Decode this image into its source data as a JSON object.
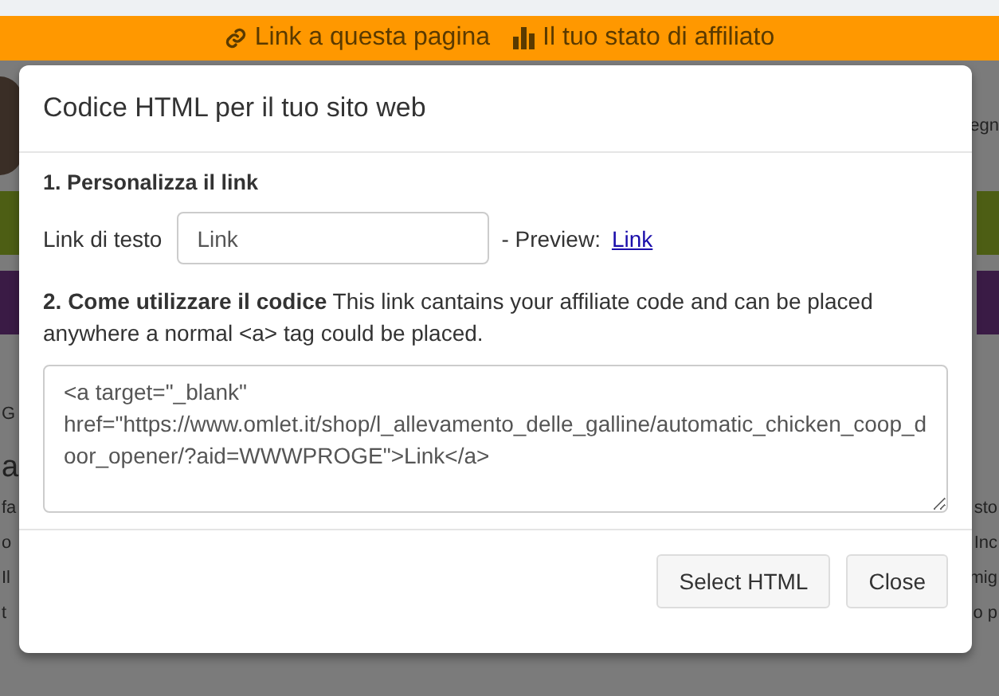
{
  "top_bar": {
    "links": [
      {
        "kind": "link",
        "label": "Link a questa pagina"
      },
      {
        "kind": "chart",
        "label": "Il tuo stato di affiliato"
      }
    ]
  },
  "background": {
    "header_right": "egn",
    "crumb": "G",
    "heading": "a",
    "lines": [
      {
        "left": "fa",
        "right": "sto"
      },
      {
        "left": "o",
        "right": "Inc"
      },
      {
        "left": "Il",
        "right": "mig"
      },
      {
        "left": "t",
        "right": "o p"
      }
    ]
  },
  "modal": {
    "title": "Codice HTML per il tuo sito web",
    "section_1": {
      "heading": "1. Personalizza il link",
      "field_label": "Link di testo",
      "field_value": "Link",
      "preview_label": "- Preview:",
      "preview_link": "Link"
    },
    "section_2": {
      "text": "**2. Come utilizzare il codice** This link cantains your affiliate code and can be placed anywhere a normal <a> tag could be placed."
    },
    "code": "<a target=\"_blank\" href=\"https://www.omlet.it/shop/l_allevamento_delle_galline/automatic_chicken_coop_door_opener/?aid=WWWPROGE\">Link</a>",
    "buttons": [
      "Select HTML",
      "Close"
    ]
  }
}
